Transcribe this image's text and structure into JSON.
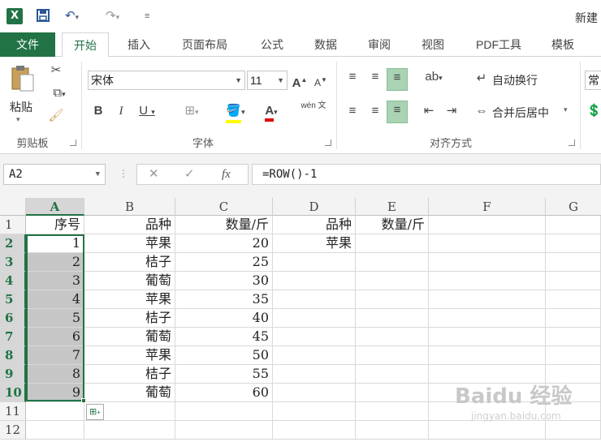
{
  "app": {
    "title": "新建",
    "logo": "X"
  },
  "tabs": [
    {
      "label": "文件"
    },
    {
      "label": "开始"
    },
    {
      "label": "插入"
    },
    {
      "label": "页面布局"
    },
    {
      "label": "公式"
    },
    {
      "label": "数据"
    },
    {
      "label": "审阅"
    },
    {
      "label": "视图"
    },
    {
      "label": "PDF工具"
    },
    {
      "label": "模板"
    }
  ],
  "ribbon": {
    "clipboard": {
      "paste_label": "粘贴",
      "group_label": "剪贴板"
    },
    "font": {
      "font_name": "宋体",
      "font_size": "11",
      "group_label": "字体",
      "bold": "B",
      "italic": "I",
      "underline": "U",
      "grow": "A",
      "shrink": "A",
      "font_color_glyph": "A",
      "phonetic_glyph": "wén 文"
    },
    "alignment": {
      "wrap_label": "自动换行",
      "merge_label": "合并后居中",
      "group_label": "对齐方式"
    },
    "number": {
      "format_label": "常"
    }
  },
  "formula_bar": {
    "name_box": "A2",
    "formula": "=ROW()-1",
    "fx": "fx"
  },
  "sheet": {
    "columns": [
      "A",
      "B",
      "C",
      "D",
      "E",
      "F",
      "G"
    ],
    "rows": [
      "1",
      "2",
      "3",
      "4",
      "5",
      "6",
      "7",
      "8",
      "9",
      "10",
      "11",
      "12"
    ],
    "headers": {
      "A": "序号",
      "B": "品种",
      "C": "数量/斤",
      "D": "品种",
      "E": "数量/斤"
    },
    "data": [
      {
        "a": "1",
        "b": "苹果",
        "c": "20",
        "d": "苹果"
      },
      {
        "a": "2",
        "b": "桔子",
        "c": "25",
        "d": ""
      },
      {
        "a": "3",
        "b": "葡萄",
        "c": "30",
        "d": ""
      },
      {
        "a": "4",
        "b": "苹果",
        "c": "35",
        "d": ""
      },
      {
        "a": "5",
        "b": "桔子",
        "c": "40",
        "d": ""
      },
      {
        "a": "6",
        "b": "葡萄",
        "c": "45",
        "d": ""
      },
      {
        "a": "7",
        "b": "苹果",
        "c": "50",
        "d": ""
      },
      {
        "a": "8",
        "b": "桔子",
        "c": "55",
        "d": ""
      },
      {
        "a": "9",
        "b": "葡萄",
        "c": "60",
        "d": ""
      }
    ]
  },
  "watermark": {
    "main": "Baidu 经验",
    "sub": "jingyan.baidu.com"
  },
  "colors": {
    "accent": "#217346",
    "selection": "#c6c6c6"
  }
}
